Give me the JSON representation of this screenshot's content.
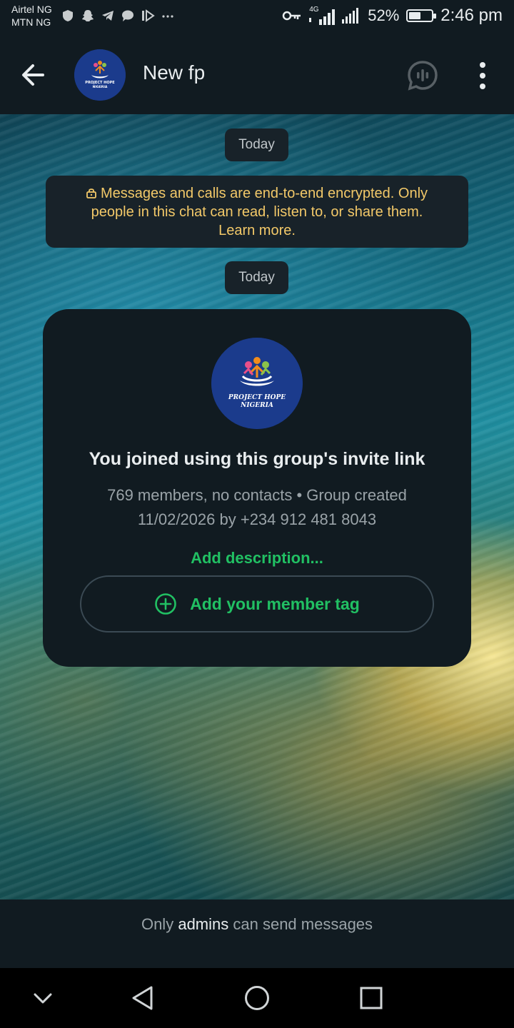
{
  "status_bar": {
    "carrier_1": "Airtel NG",
    "carrier_2": "MTN NG",
    "network_type": "4G",
    "battery_percent": "52%",
    "battery_level": 0.52,
    "time": "2:46 pm",
    "notification_icons": [
      "vpn-icon",
      "snapchat-icon",
      "telegram-icon",
      "chat-bubble-icon",
      "play-icon",
      "more-notifications-icon"
    ]
  },
  "header": {
    "title": "New fp",
    "avatar_text_1": "PROJECT HOPE",
    "avatar_text_2": "NIGERIA"
  },
  "chat": {
    "date_chip_1": "Today",
    "encryption_line_1": "Messages and calls are end-to-end encrypted. Only",
    "encryption_line_2": "people in this chat can read, listen to, or share them.",
    "encryption_line_3": "Learn more.",
    "date_chip_2": "Today"
  },
  "group_card": {
    "logo_text_1": "PROJECT HOPE",
    "logo_text_2": "NIGERIA",
    "heading": "You joined using this group's invite link",
    "info_line_1": "769 members, no contacts • Group created",
    "info_line_2": "11/02/2026 by +234 912 481 8043",
    "add_description": "Add description...",
    "member_tag_button": "Add your member tag"
  },
  "footer": {
    "prefix": "Only",
    "highlight": "admins",
    "suffix": "can send messages"
  },
  "colors": {
    "accent_green": "#21c063",
    "encryption_text": "#f3c969",
    "panel": "#111b21"
  }
}
